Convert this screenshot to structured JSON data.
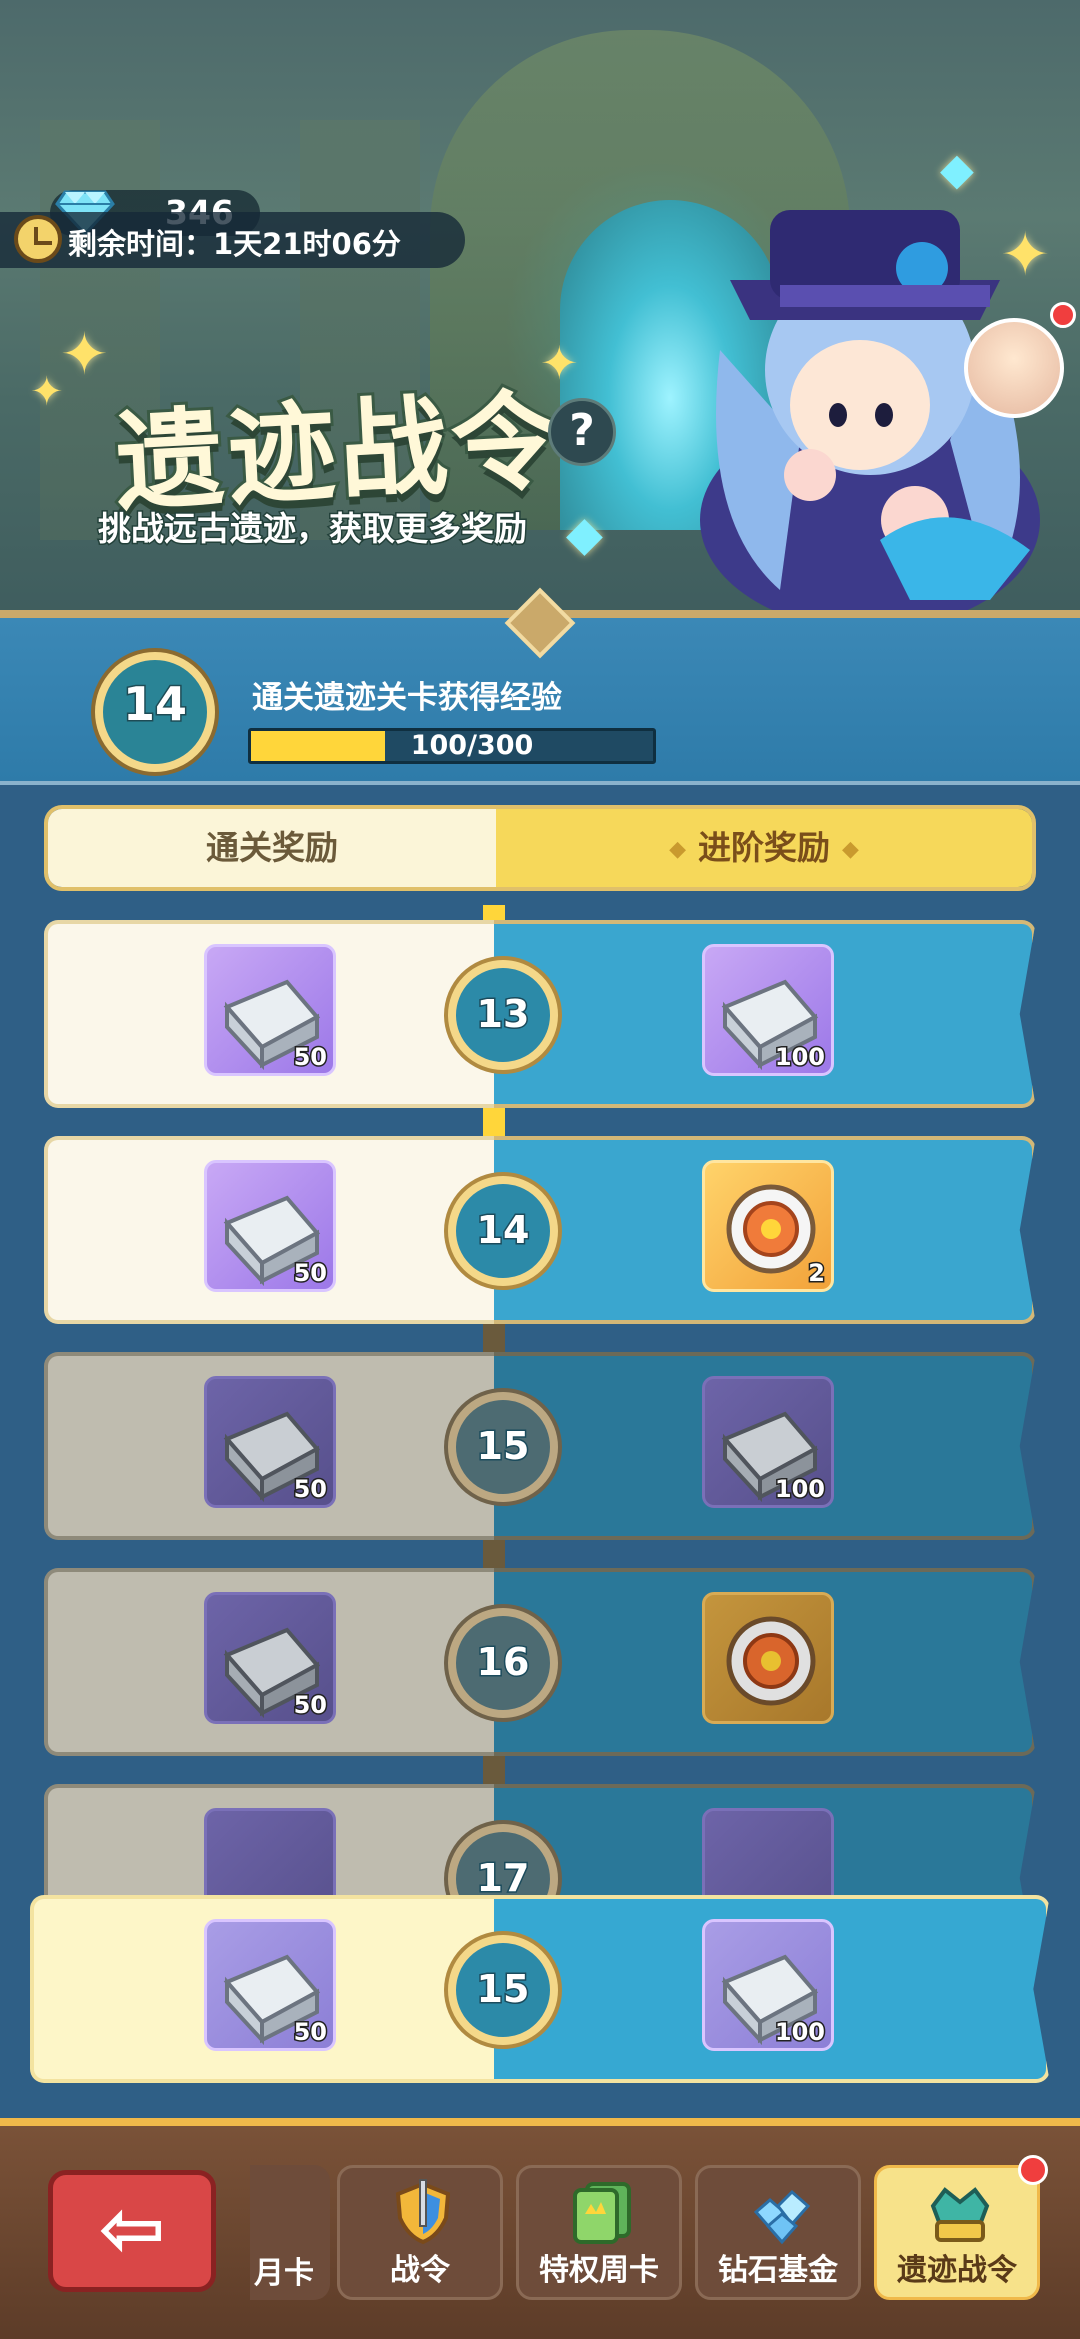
{
  "header": {
    "gem_count": "346",
    "remaining_time": "剩余时间：1天21时06分",
    "title": "遗迹战令",
    "subtitle": "挑战远古遗迹，获取更多奖励",
    "help_symbol": "?"
  },
  "level": {
    "current": "14",
    "exp_label": "通关遗迹关卡获得经验",
    "exp_text": "100/300",
    "exp_current": 100,
    "exp_max": 300
  },
  "tabs": {
    "free": "通关奖励",
    "paid": "进阶奖励",
    "ornament": "◆"
  },
  "rows": [
    {
      "level": "13",
      "free_count": "50",
      "paid_count": "100"
    },
    {
      "level": "14",
      "free_count": "50",
      "paid_count": "2"
    },
    {
      "level": "15",
      "free_count": "50",
      "paid_count": "100"
    },
    {
      "level": "16",
      "free_count": "50",
      "paid_count": ""
    },
    {
      "level": "17",
      "free_count": "",
      "paid_count": ""
    }
  ],
  "sticky_row": {
    "level": "15",
    "free_count": "50",
    "paid_count": "100"
  },
  "nav": {
    "back_symbol": "⇦",
    "partial_label": "月卡",
    "tabs": [
      "战令",
      "特权周卡",
      "钻石基金",
      "遗迹战令"
    ]
  },
  "colors": {
    "accent_gold": "#f4d889",
    "exp_bar": "#ffd63a",
    "paid_lane": "#3aa6cf",
    "badge_red": "#f03e3e"
  }
}
